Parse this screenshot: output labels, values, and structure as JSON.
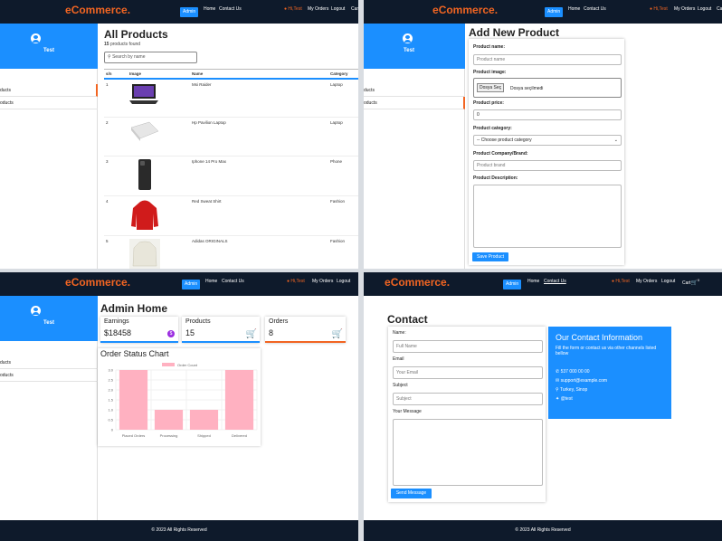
{
  "header": {
    "logo_e": "e",
    "logo_rest": "Commerce.",
    "admin": "Admin",
    "home": "Home",
    "contact": "Contact Us",
    "hi_user": "Hi,Test",
    "my_orders": "My Orders",
    "logout": "Logout",
    "cart": "Cart",
    "cart_count": "0"
  },
  "sidebar": {
    "username": "Test",
    "items": [
      "ducts",
      "oducts"
    ]
  },
  "products_page": {
    "title": "All Products",
    "count_num": "15",
    "count_text": "products found",
    "search_placeholder": "Search by name",
    "columns": [
      "s/n",
      "Image",
      "Name",
      "Category"
    ],
    "rows": [
      {
        "sn": "1",
        "name": "Msi Raider",
        "category": "Laptop"
      },
      {
        "sn": "2",
        "name": "Hp Pavilion Laptop",
        "category": "Laptop"
      },
      {
        "sn": "3",
        "name": "Iphone 14 Pro Max",
        "category": "Phone"
      },
      {
        "sn": "4",
        "name": "Red Sweat Shirt",
        "category": "Fashion"
      },
      {
        "sn": "5",
        "name": "Adidas ORIGINALS",
        "category": "Fashion"
      }
    ]
  },
  "add_product": {
    "title": "Add New Product",
    "name_label": "Product name:",
    "name_placeholder": "Product name",
    "image_label": "Product image:",
    "file_button": "Dosya Seç",
    "file_text": "Dosya seçilmedi",
    "price_label": "Product price:",
    "price_value": "0",
    "category_label": "Product category:",
    "category_value": "-- Choose product category",
    "brand_label": "Product Company/Brand:",
    "brand_placeholder": "Product brand",
    "desc_label": "Product Description:",
    "save_button": "Save Product"
  },
  "admin_home": {
    "title": "Admin Home",
    "cards": [
      {
        "title": "Earnings",
        "value": "$18458",
        "color": "#1b8fff"
      },
      {
        "title": "Products",
        "value": "15",
        "color": "#1b8fff"
      },
      {
        "title": "Orders",
        "value": "8",
        "color": "#f26522"
      }
    ],
    "chart_title": "Order Status Chart",
    "footer": "© 2023 All Rights Reserved"
  },
  "chart_data": {
    "type": "bar",
    "legend": "Order Count",
    "categories": [
      "Placed Orders",
      "Processing",
      "Shipped",
      "Delivered"
    ],
    "values": [
      3,
      1,
      1,
      3
    ],
    "yticks": [
      "0",
      "0.5",
      "1.0",
      "1.5",
      "2.0",
      "2.5",
      "3.0"
    ],
    "ylim": [
      0,
      3
    ],
    "color": "#ffb1c1"
  },
  "contact": {
    "title": "Contact",
    "name_label": "Name:",
    "name_placeholder": "Full Name",
    "email_label": "Email",
    "email_placeholder": "Your Email",
    "subject_label": "Subject",
    "subject_placeholder": "Subject",
    "message_label": "Your Message",
    "send_button": "Send Message",
    "info_title": "Our Contact Information",
    "info_text": "Fill the form or contact us via other channels listed bellow",
    "phone": "537 000 00 00",
    "email": "support@example.com",
    "location": "Turkey, Sinop",
    "twitter": "@test",
    "footer": "© 2023 All Rights Reserved"
  }
}
